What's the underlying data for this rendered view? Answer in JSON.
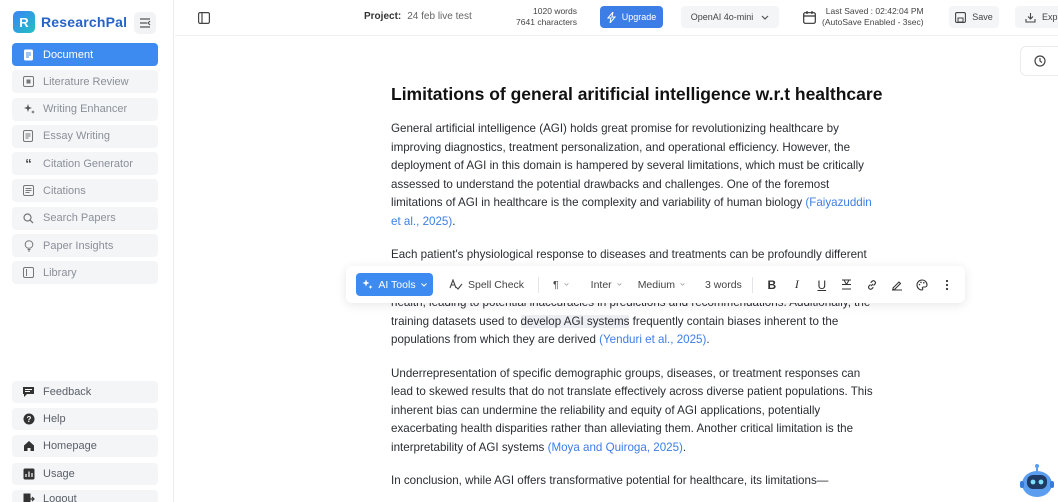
{
  "brand": {
    "name": "ResearchPal",
    "logo_letter": "R"
  },
  "sidebar": {
    "items": [
      {
        "label": "Document",
        "icon": "document-icon",
        "active": true
      },
      {
        "label": "Literature Review",
        "icon": "literature-icon"
      },
      {
        "label": "Writing Enhancer",
        "icon": "sparkle-icon"
      },
      {
        "label": "Essay Writing",
        "icon": "essay-icon"
      },
      {
        "label": "Citation Generator",
        "icon": "quote-icon"
      },
      {
        "label": "Citations",
        "icon": "citations-icon"
      },
      {
        "label": "Search Papers",
        "icon": "search-icon"
      },
      {
        "label": "Paper Insights",
        "icon": "bulb-icon"
      },
      {
        "label": "Library",
        "icon": "library-icon"
      }
    ],
    "bottom_items": [
      {
        "label": "Feedback",
        "icon": "feedback-icon"
      },
      {
        "label": "Help",
        "icon": "help-icon"
      },
      {
        "label": "Homepage",
        "icon": "home-icon"
      },
      {
        "label": "Usage",
        "icon": "usage-icon"
      },
      {
        "label": "Logout",
        "icon": "logout-icon"
      }
    ]
  },
  "topbar": {
    "project_label": "Project:",
    "project_name": "24 feb live test",
    "words": "1020 words",
    "characters": "7641 characters",
    "upgrade_label": "Upgrade",
    "model": "OpenAI 4o-mini",
    "last_saved": "Last Saved : 02:42:04 PM",
    "autosave": "(AutoSave Enabled - 3sec)",
    "save_label": "Save",
    "export_label": "Exp"
  },
  "document": {
    "title": "Limitations of general aritificial intelligence w.r.t healthcare",
    "p1": "General artificial intelligence (AGI) holds great promise for revolutionizing healthcare by improving diagnostics, treatment personalization, and operational efficiency. However, the deployment of AGI in this domain is hampered by several limitations, which must be critically assessed to understand the potential drawbacks and challenges. One of the foremost limitations of AGI in healthcare is the complexity and variability of human biology ",
    "p1_cite": "(Faiyazuddin et al., 2025)",
    "p1_end": ".",
    "p2": "Each patient's physiological response to diseases and treatments can be profoundly different",
    "p3_a": "health, leading to potential inaccuracies in predictions and recommendations. Additionally, the training datasets used to ",
    "p3_hl": "develop AGI systems",
    "p3_b": " frequently contain biases inherent to the populations from which they are derived ",
    "p3_cite": "(Yenduri et al., 2025)",
    "p3_end": ".",
    "p4": "Underrepresentation of specific demographic groups, diseases, or treatment responses can lead to skewed results that do not translate effectively across diverse patient populations. This inherent bias can undermine the reliability and equity of AGI applications, potentially exacerbating health disparities rather than alleviating them. Another critical limitation is the interpretability of AGI systems ",
    "p4_cite": "(Moya and Quiroga, 2025)",
    "p4_end": ".",
    "p5": "In conclusion, while AGI offers transformative potential for healthcare, its limitations—"
  },
  "toolbar": {
    "ai_tools": "AI Tools",
    "spell_check": "Spell Check",
    "paragraph_symbol": "¶",
    "font": "Inter",
    "weight": "Medium",
    "selection_count": "3 words"
  },
  "colors": {
    "accent": "#3d8bf0",
    "citation": "#3d7de6"
  }
}
